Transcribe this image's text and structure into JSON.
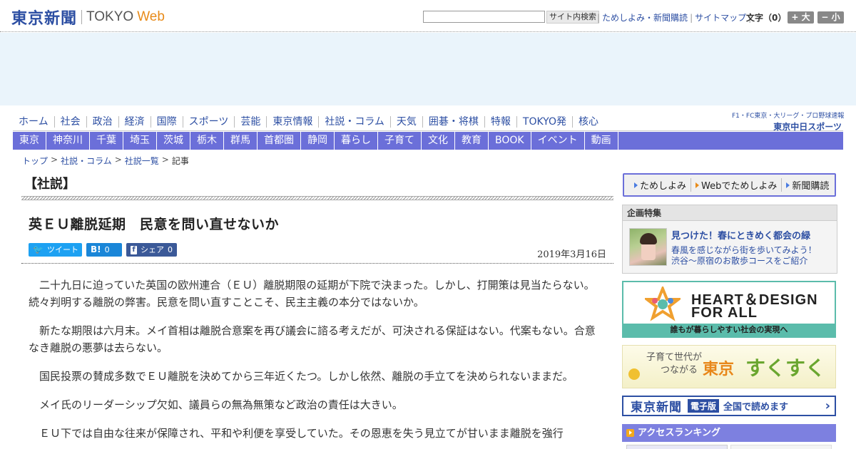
{
  "header": {
    "logo_jp": "東京新聞",
    "logo_tokyo": "TOKYO",
    "logo_web": "Web",
    "search_button": "サイト内検索",
    "links": [
      "ためしよみ・新聞購読",
      "サイトマップ"
    ],
    "font_size_label": "文字（0）",
    "font_larger": "+ 大",
    "font_smaller": "− 小"
  },
  "gnav": {
    "items": [
      "ホーム",
      "社会",
      "政治",
      "経済",
      "国際",
      "スポーツ",
      "芸能",
      "東京情報",
      "社説・コラム",
      "天気",
      "囲碁・将棋",
      "特報",
      "TOKYO発",
      "核心"
    ],
    "sports_top": "F1・FC東京・大リーグ・プロ野球速報",
    "sports_main": "東京中日スポーツ"
  },
  "lnav": {
    "items": [
      "東京",
      "神奈川",
      "千葉",
      "埼玉",
      "茨城",
      "栃木",
      "群馬",
      "首都圏",
      "静岡",
      "暮らし",
      "子育て",
      "文化",
      "教育",
      "BOOK",
      "イベント",
      "動画"
    ]
  },
  "breadcrumb": {
    "items": [
      "トップ",
      "社説・コラム",
      "社説一覧"
    ],
    "current": "記事"
  },
  "article": {
    "section": "【社説】",
    "title": "英ＥＵ離脱延期　民意を問い直せないか",
    "share_tweet": "ツイート",
    "share_hatena_icon": "B!",
    "share_hatena_count": "0",
    "share_fb_label": "シェア",
    "share_fb_count": "0",
    "date": "2019年3月16日",
    "paragraphs": [
      "二十九日に迫っていた英国の欧州連合（ＥＵ）離脱期限の延期が下院で決まった。しかし、打開策は見当たらない。続々判明する離脱の弊害。民意を問い直すことこそ、民主主義の本分ではないか。",
      "新たな期限は六月末。メイ首相は離脱合意案を再び議会に諮る考えだが、可決される保証はない。代案もない。合意なき離脱の悪夢は去らない。",
      "国民投票の賛成多数でＥＵ離脱を決めてから三年近くたつ。しかし依然、離脱の手立てを決められないままだ。",
      "メイ氏のリーダーシップ欠如、議員らの無為無策など政治の責任は大きい。",
      "ＥＵ下では自由な往来が保障され、平和や利便を享受していた。その恩恵を失う見立てが甘いまま離脱を強行"
    ]
  },
  "sidebar": {
    "subs": [
      "ためしよみ",
      "Webでためしよみ",
      "新聞購読"
    ],
    "feature_head": "企画特集",
    "feature_title": "見つけた！春にときめく都会の緑",
    "feature_text_1": "春風を感じながら街を歩いてみよう！",
    "feature_text_2": "渋谷～原宿のお散歩コースをご紹介",
    "hd_line1": "HEART＆DESIGN",
    "hd_line2": "FOR ALL",
    "hd_caption": "誰もが暮らしやすい社会の実現へ",
    "suku_small_1": "子育て世代が",
    "suku_small_2": "つながる",
    "suku_tokyo": "東京",
    "suku_big": "すくすく",
    "denshi_name": "東京新聞",
    "denshi_badge": "電子版",
    "denshi_text": "全国で読めます",
    "ranking": "アクセスランキング"
  }
}
